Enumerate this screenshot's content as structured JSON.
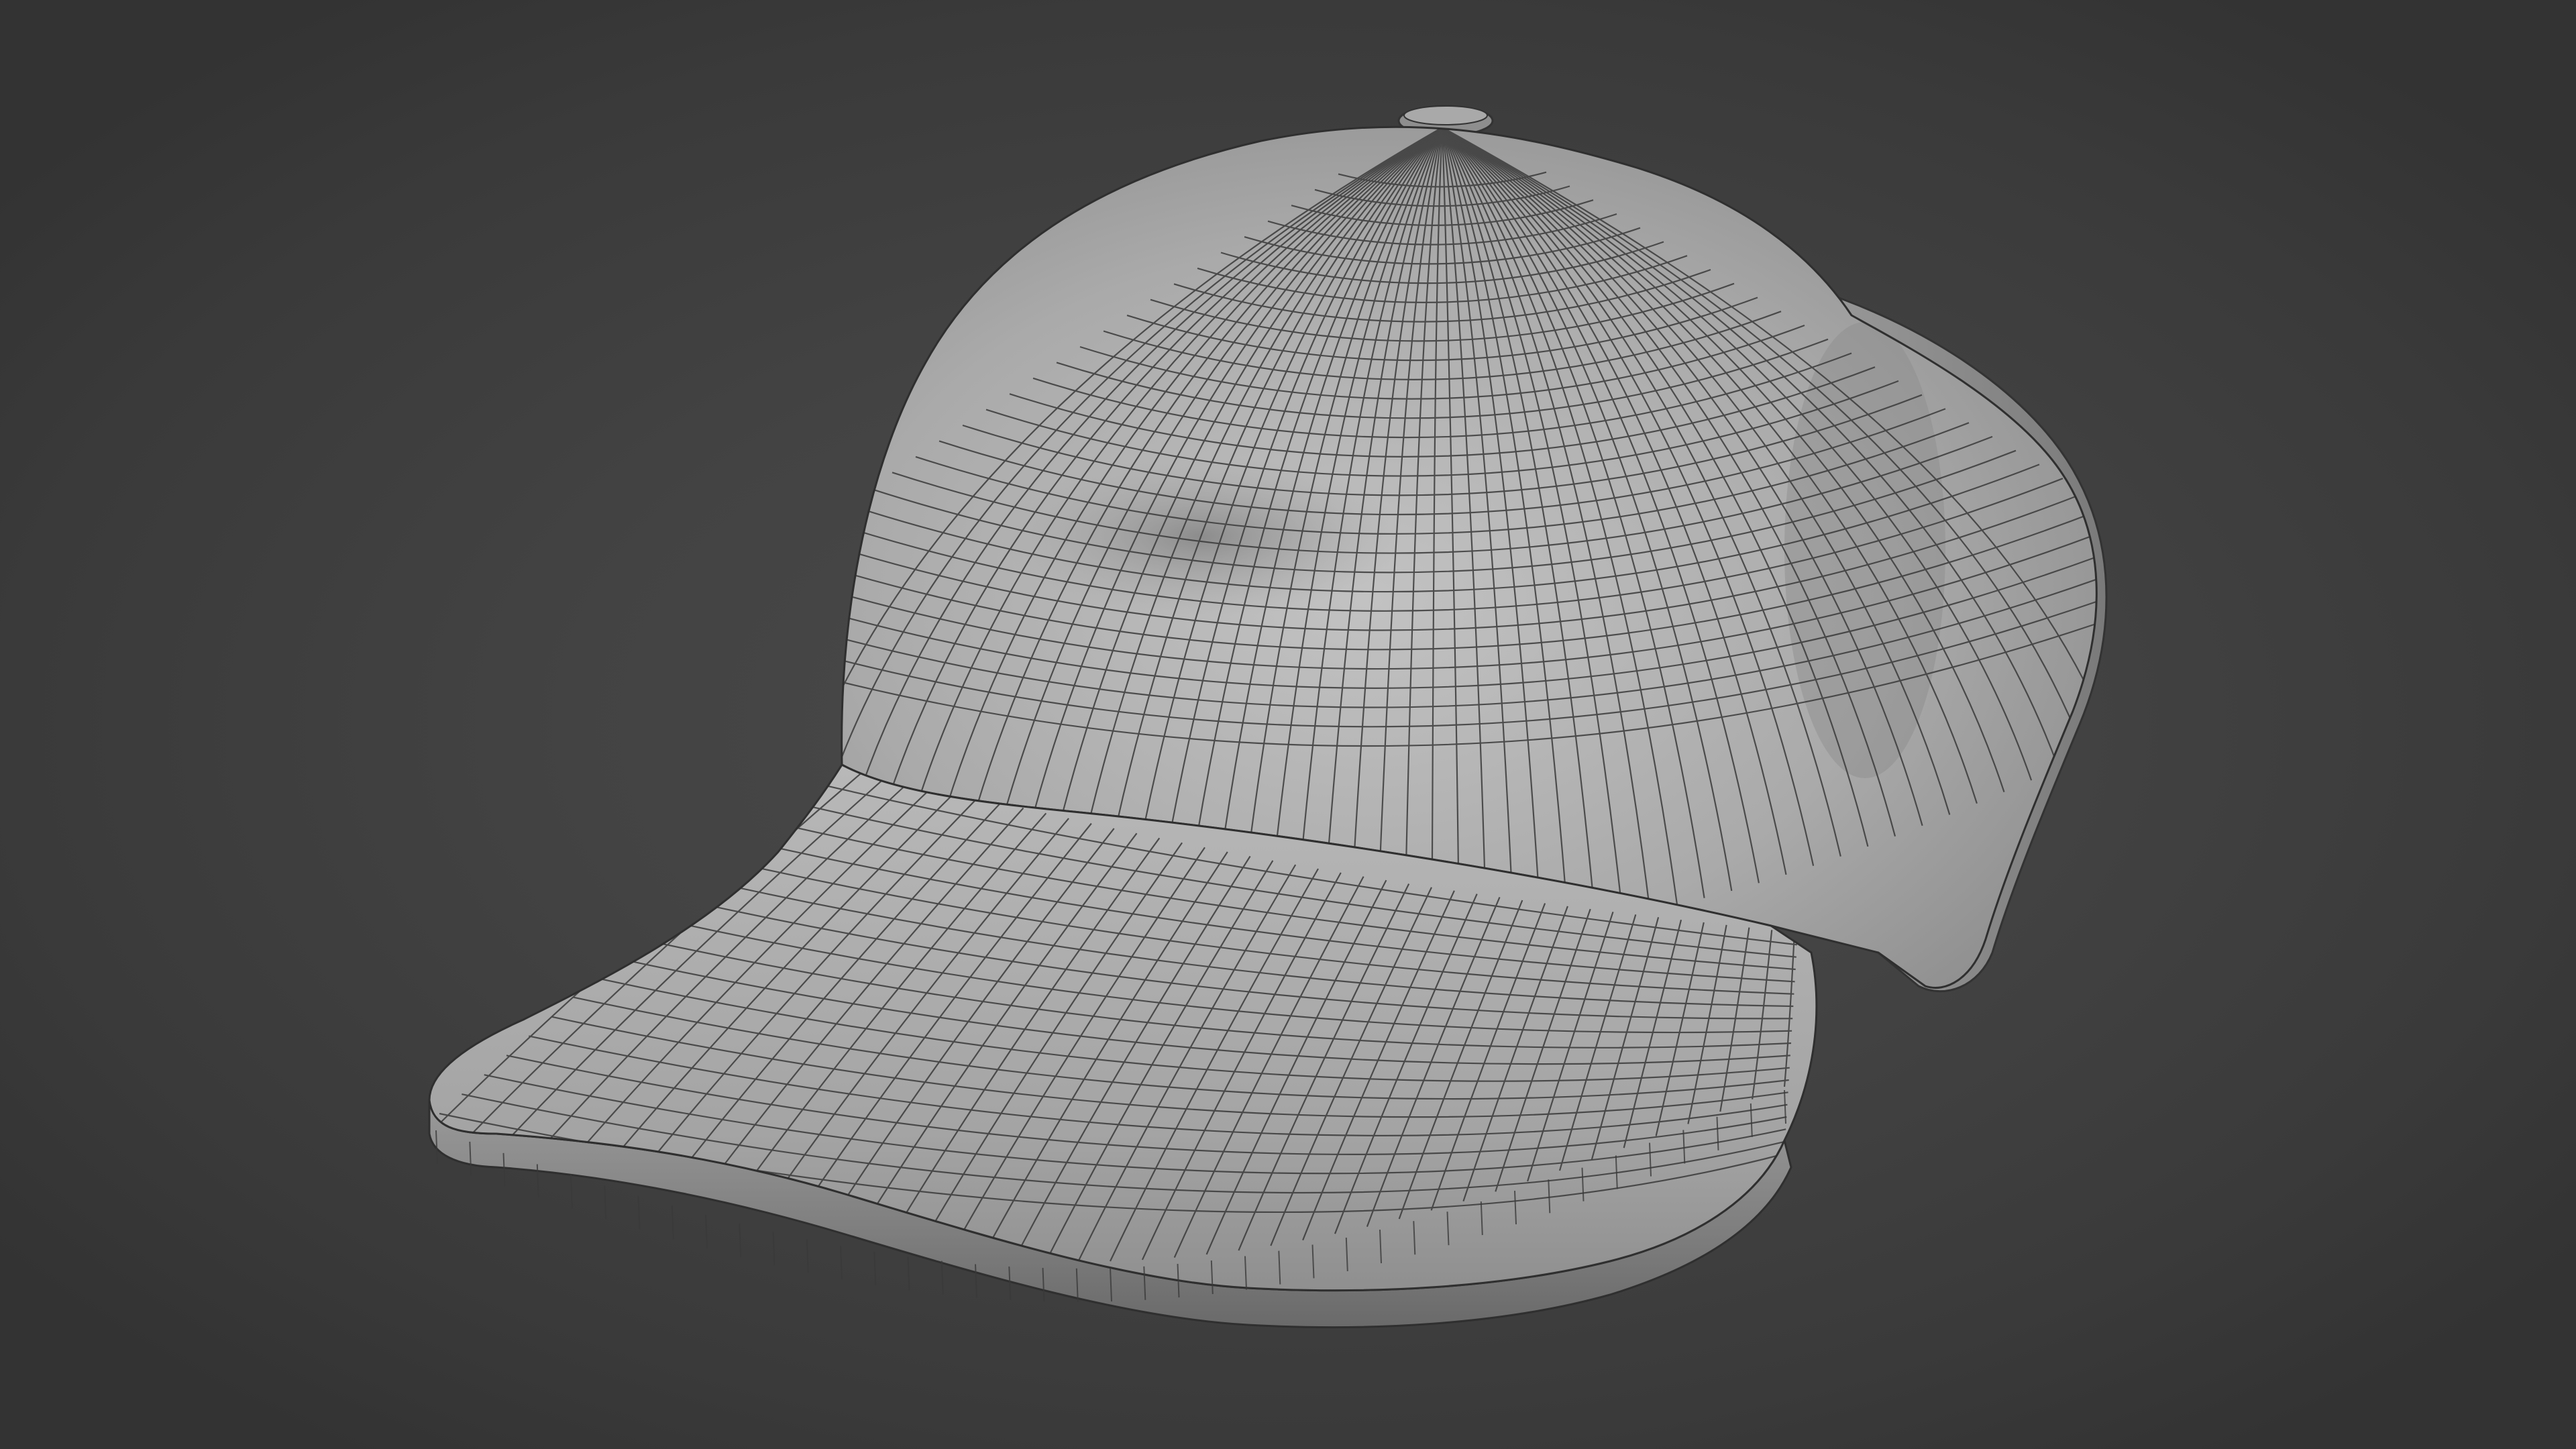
{
  "scene": {
    "object": "baseball-cap",
    "render_mode": "solid-wireframe",
    "colors": {
      "background_center": "#4a4a4a",
      "background_edge": "#333333",
      "mesh_light": "#bdbdbd",
      "mesh_mid": "#9e9e9e",
      "mesh_shadow": "#6e6e6e",
      "wire": "#333333"
    }
  }
}
